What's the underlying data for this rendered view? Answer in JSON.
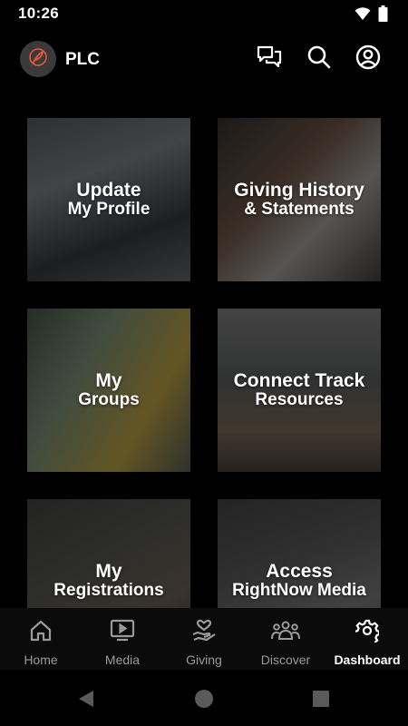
{
  "status_bar": {
    "time": "10:26"
  },
  "header": {
    "app_name": "PLC",
    "logo_icon": "feather-icon",
    "icons": [
      "chat-icon",
      "search-icon",
      "account-icon"
    ]
  },
  "tiles": [
    {
      "line1": "Update",
      "line2": "My Profile"
    },
    {
      "line1": "Giving History",
      "line2": "& Statements"
    },
    {
      "line1": "My",
      "line2": "Groups"
    },
    {
      "line1": "Connect Track",
      "line2": "Resources"
    },
    {
      "line1": "My",
      "line2": "Registrations"
    },
    {
      "line1": "Access",
      "line2": "RightNow Media"
    }
  ],
  "bottom_nav": [
    {
      "label": "Home",
      "icon": "home-icon",
      "active": false
    },
    {
      "label": "Media",
      "icon": "media-icon",
      "active": false
    },
    {
      "label": "Giving",
      "icon": "giving-icon",
      "active": false
    },
    {
      "label": "Discover",
      "icon": "people-icon",
      "active": false
    },
    {
      "label": "Dashboard",
      "icon": "gear-icon",
      "active": true
    }
  ],
  "colors": {
    "background": "#000000",
    "logo_accent": "#e8563a",
    "nav_inactive": "#9a9a9a",
    "nav_active": "#ffffff"
  }
}
